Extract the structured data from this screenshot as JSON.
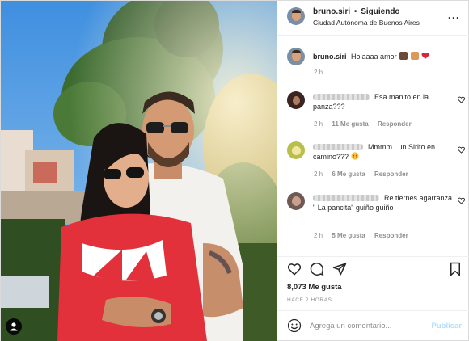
{
  "header": {
    "username": "bruno.siri",
    "separator": "•",
    "follow_status": "Siguiendo",
    "location": "Ciudad Autónoma de Buenos Aires",
    "more_icon": "more-horizontal-icon"
  },
  "caption": {
    "username": "bruno.siri",
    "text": "Holaaaa amor",
    "emojis": [
      "couple-kiss-emoji",
      "folded-hands-emoji",
      "red-heart-emoji"
    ],
    "time": "2 h"
  },
  "comments": [
    {
      "text": "Esa manito en la panza???",
      "time": "2 h",
      "likes": "11 Me gusta",
      "reply": "Responder"
    },
    {
      "text": "Mmmm...un Sirito en camino???",
      "time": "2 h",
      "likes": "6 Me gusta",
      "reply": "Responder"
    },
    {
      "text": "Re tiernes agarranza \" La pancita\" guiño guiño",
      "time": "2 h",
      "likes": "5 Me gusta",
      "reply": "Responder"
    }
  ],
  "actions": {
    "like_icon": "heart-icon",
    "comment_icon": "comment-icon",
    "share_icon": "paper-plane-icon",
    "save_icon": "bookmark-icon"
  },
  "likes_text": "8,073 Me gusta",
  "time_ago": "HACE 2 HORAS",
  "add_comment": {
    "placeholder": "Agrega un comentario...",
    "publish_label": "Publicar"
  },
  "colors": {
    "sky": "#5aa3e6",
    "publish_disabled": "#b2dffc",
    "heart_red": "#ed4956",
    "muted_text": "#8e8e8e"
  }
}
